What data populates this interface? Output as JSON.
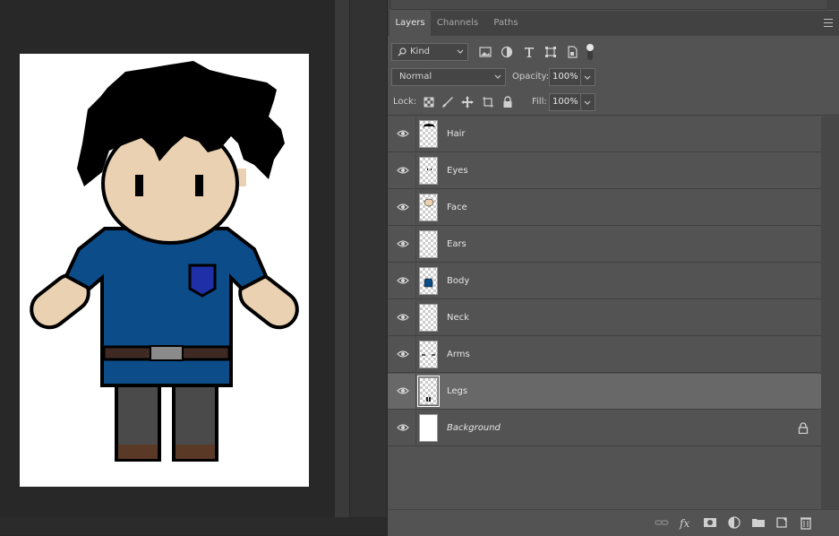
{
  "tabs": [
    {
      "label": "Layers",
      "active": true
    },
    {
      "label": "Channels",
      "active": false
    },
    {
      "label": "Paths",
      "active": false
    }
  ],
  "filter": {
    "kind_label": "Kind",
    "icons": [
      "image-filter-icon",
      "adjustment-filter-icon",
      "type-filter-icon",
      "shape-filter-icon",
      "smart-object-filter-icon",
      "filter-toggle-icon"
    ]
  },
  "blend": {
    "mode": "Normal",
    "opacity_label": "Opacity:",
    "opacity_value": "100%"
  },
  "lock": {
    "label": "Lock:",
    "fill_label": "Fill:",
    "fill_value": "100%",
    "icons": [
      "lock-transparent-icon",
      "lock-image-icon",
      "lock-position-icon",
      "lock-artboard-icon",
      "lock-all-icon"
    ]
  },
  "layers": [
    {
      "name": "Hair",
      "selected": false,
      "thumb": "hair"
    },
    {
      "name": "Eyes",
      "selected": false,
      "thumb": "eyes"
    },
    {
      "name": "Face",
      "selected": false,
      "thumb": "face"
    },
    {
      "name": "Ears",
      "selected": false,
      "thumb": "ears"
    },
    {
      "name": "Body",
      "selected": false,
      "thumb": "body"
    },
    {
      "name": "Neck",
      "selected": false,
      "thumb": "neck"
    },
    {
      "name": "Arms",
      "selected": false,
      "thumb": "arms"
    },
    {
      "name": "Legs",
      "selected": true,
      "thumb": "legs"
    },
    {
      "name": "Background",
      "selected": false,
      "thumb": "background",
      "locked": true,
      "italic": true
    }
  ],
  "footer_icons": [
    "link-layers-icon",
    "fx-icon",
    "layer-mask-icon",
    "adjustment-layer-icon",
    "group-folder-icon",
    "new-layer-icon",
    "trash-icon"
  ],
  "colors": {
    "panel": "#535353",
    "selected_row": "#686868",
    "shirt": "#0c4c89",
    "skin": "#ead1b1",
    "pants": "#4a4a4a",
    "belt": "#3e2a22"
  }
}
